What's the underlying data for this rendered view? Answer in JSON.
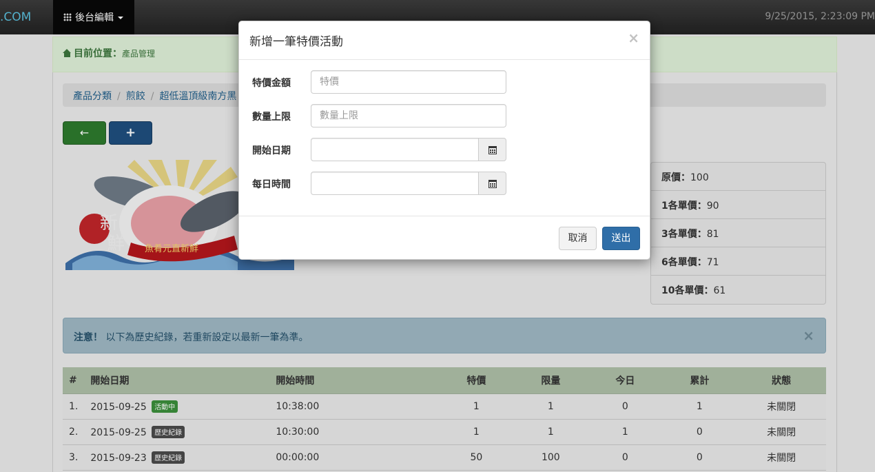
{
  "navbar": {
    "brand": ".COM",
    "menu_label": "後台編輯",
    "clock": "9/25/2015, 2:23:09 PM"
  },
  "location": {
    "label": "目前位置：",
    "value": "產品管理"
  },
  "breadcrumb": [
    "產品分類",
    "煎餃",
    "超低溫頂級南方黑"
  ],
  "buttons": {
    "back": "←",
    "add": "+"
  },
  "prices": [
    {
      "label": "原價：",
      "value": "100"
    },
    {
      "label": "1各單價：",
      "value": "90"
    },
    {
      "label": "3各單價：",
      "value": "81"
    },
    {
      "label": "6各單價：",
      "value": "71"
    },
    {
      "label": "10各單價：",
      "value": "61"
    }
  ],
  "alert": {
    "strong": "注意！",
    "text": "以下為歷史紀錄，若重新設定以最新一筆為準。",
    "close": "×"
  },
  "table": {
    "headers": [
      "#",
      "開始日期",
      "開始時間",
      "特價",
      "限量",
      "今日",
      "累計",
      "狀態"
    ],
    "rows": [
      {
        "no": "1.",
        "date": "2015-09-25",
        "tag": "活動中",
        "time": "10:38:00",
        "price": "1",
        "limit": "1",
        "today": "0",
        "total": "1",
        "status": "未關閉"
      },
      {
        "no": "2.",
        "date": "2015-09-25",
        "tag": "歷史紀錄",
        "time": "10:30:00",
        "price": "1",
        "limit": "1",
        "today": "1",
        "total": "0",
        "status": "未關閉"
      },
      {
        "no": "3.",
        "date": "2015-09-23",
        "tag": "歷史紀錄",
        "time": "00:00:00",
        "price": "50",
        "limit": "100",
        "today": "0",
        "total": "0",
        "status": "未關閉"
      }
    ]
  },
  "modal": {
    "title": "新增一筆特價活動",
    "close": "×",
    "fields": {
      "price_label": "特價金額",
      "price_placeholder": "特價",
      "qty_label": "數量上限",
      "qty_placeholder": "數量上限",
      "start_date_label": "開始日期",
      "daily_time_label": "每日時間"
    },
    "cancel_label": "取消",
    "submit_label": "送出"
  },
  "colors": {
    "navbar": "#222222",
    "success": "#dff0d8",
    "primary": "#2f6ea8"
  }
}
